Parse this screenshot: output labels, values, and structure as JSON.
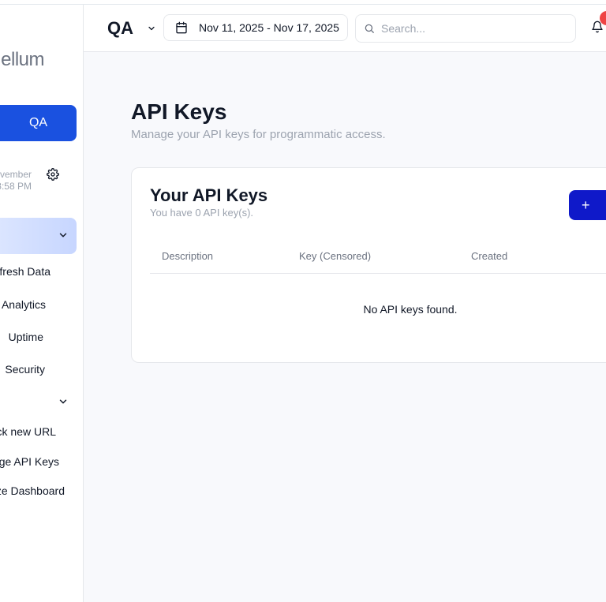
{
  "sidebar": {
    "logo": "ellum",
    "project_button": "QA",
    "sync": {
      "line1": "vember",
      "line2": "3:58 PM"
    },
    "items": [
      {
        "label": "fresh Data",
        "name": "sidebar-item-refresh-data"
      },
      {
        "label": "Analytics",
        "name": "sidebar-item-analytics"
      },
      {
        "label": "Uptime",
        "name": "sidebar-item-uptime"
      },
      {
        "label": "Security",
        "name": "sidebar-item-security"
      }
    ],
    "items2": [
      {
        "label": "ck new URL",
        "name": "sidebar-item-track-new-url"
      },
      {
        "label": "ge API Keys",
        "name": "sidebar-item-manage-api-keys"
      },
      {
        "label": "ze Dashboard",
        "name": "sidebar-item-customize-dashboard"
      }
    ]
  },
  "header": {
    "project": "QA",
    "date_range": "Nov 11, 2025 - Nov 17, 2025",
    "search_placeholder": "Search..."
  },
  "page": {
    "title": "API Keys",
    "subtitle": "Manage your API keys for programmatic access."
  },
  "card": {
    "title": "Your API Keys",
    "subtitle": "You have 0 API key(s).",
    "create_label": "+",
    "columns": [
      "Description",
      "Key (Censored)",
      "Created"
    ],
    "empty": "No API keys found."
  },
  "colors": {
    "primary": "#1a51e0",
    "create": "#0f19c9",
    "badge": "#ef4444"
  }
}
